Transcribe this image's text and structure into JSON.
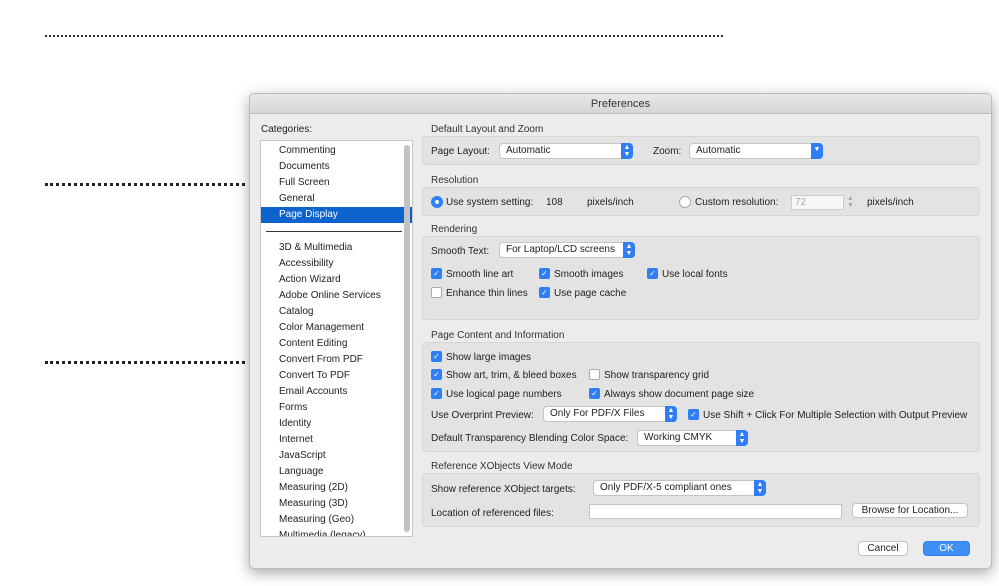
{
  "window": {
    "title": "Preferences"
  },
  "categories": {
    "label": "Categories:",
    "top": [
      "Commenting",
      "Documents",
      "Full Screen",
      "General",
      "Page Display"
    ],
    "selected": "Page Display",
    "items": [
      "3D & Multimedia",
      "Accessibility",
      "Action Wizard",
      "Adobe Online Services",
      "Catalog",
      "Color Management",
      "Content Editing",
      "Convert From PDF",
      "Convert To PDF",
      "Email Accounts",
      "Forms",
      "Identity",
      "Internet",
      "JavaScript",
      "Language",
      "Measuring (2D)",
      "Measuring (3D)",
      "Measuring (Geo)",
      "Multimedia (legacy)"
    ]
  },
  "layout": {
    "title": "Default Layout and Zoom",
    "page_layout_label": "Page Layout:",
    "page_layout": "Automatic",
    "zoom_label": "Zoom:",
    "zoom": "Automatic"
  },
  "resolution": {
    "title": "Resolution",
    "system_label": "Use system setting:",
    "system_value": "108",
    "unit": "pixels/inch",
    "custom_label": "Custom resolution:",
    "custom_value": "72",
    "custom_unit": "pixels/inch",
    "selected": "system"
  },
  "rendering": {
    "title": "Rendering",
    "smooth_text_label": "Smooth Text:",
    "smooth_text": "For Laptop/LCD screens",
    "checks": [
      {
        "label": "Smooth line art",
        "checked": true
      },
      {
        "label": "Smooth images",
        "checked": true
      },
      {
        "label": "Use local fonts",
        "checked": true
      },
      {
        "label": "Enhance thin lines",
        "checked": false
      },
      {
        "label": "Use page cache",
        "checked": true
      }
    ]
  },
  "content": {
    "title": "Page Content and Information",
    "checks": [
      {
        "label": "Show large images",
        "checked": true
      },
      {
        "label": "Show art, trim, & bleed boxes",
        "checked": true
      },
      {
        "label": "Show transparency grid",
        "checked": false
      },
      {
        "label": "Use logical page numbers",
        "checked": true
      },
      {
        "label": "Always show document page size",
        "checked": true
      }
    ],
    "overprint_label": "Use Overprint Preview:",
    "overprint": "Only For PDF/X Files",
    "shift_click": {
      "label": "Use Shift + Click For Multiple Selection with Output Preview",
      "checked": true
    },
    "blend_label": "Default Transparency Blending Color Space:",
    "blend": "Working CMYK"
  },
  "xobjects": {
    "title": "Reference XObjects View Mode",
    "targets_label": "Show reference XObject targets:",
    "targets": "Only PDF/X-5 compliant ones",
    "location_label": "Location of referenced files:",
    "location": "",
    "browse": "Browse for Location..."
  },
  "buttons": {
    "cancel": "Cancel",
    "ok": "OK"
  },
  "colors": {
    "accent": "#2f7ef6",
    "selection": "#0b63ce"
  }
}
